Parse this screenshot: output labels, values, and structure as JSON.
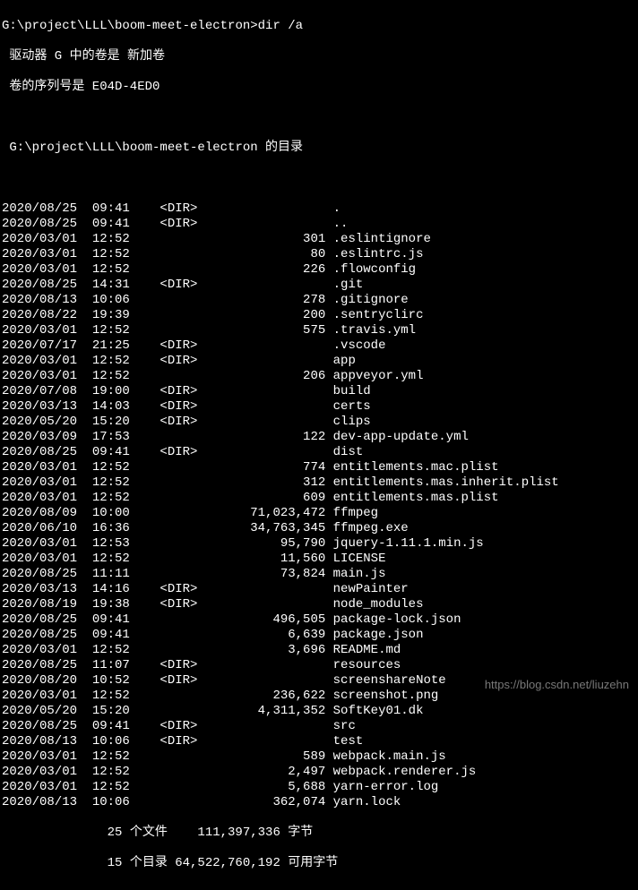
{
  "prompt": "G:\\project\\LLL\\boom-meet-electron>dir /a",
  "drive_info": " 驱动器 G 中的卷是 新加卷",
  "serial_info": " 卷的序列号是 E04D-4ED0",
  "dir_of": " G:\\project\\LLL\\boom-meet-electron 的目录",
  "entries": [
    {
      "date": "2020/08/25",
      "time": "09:41",
      "dir": "<DIR>",
      "size": "",
      "name": "."
    },
    {
      "date": "2020/08/25",
      "time": "09:41",
      "dir": "<DIR>",
      "size": "",
      "name": ".."
    },
    {
      "date": "2020/03/01",
      "time": "12:52",
      "dir": "",
      "size": "301",
      "name": ".eslintignore"
    },
    {
      "date": "2020/03/01",
      "time": "12:52",
      "dir": "",
      "size": "80",
      "name": ".eslintrc.js"
    },
    {
      "date": "2020/03/01",
      "time": "12:52",
      "dir": "",
      "size": "226",
      "name": ".flowconfig"
    },
    {
      "date": "2020/08/25",
      "time": "14:31",
      "dir": "<DIR>",
      "size": "",
      "name": ".git"
    },
    {
      "date": "2020/08/13",
      "time": "10:06",
      "dir": "",
      "size": "278",
      "name": ".gitignore"
    },
    {
      "date": "2020/08/22",
      "time": "19:39",
      "dir": "",
      "size": "200",
      "name": ".sentryclirc"
    },
    {
      "date": "2020/03/01",
      "time": "12:52",
      "dir": "",
      "size": "575",
      "name": ".travis.yml"
    },
    {
      "date": "2020/07/17",
      "time": "21:25",
      "dir": "<DIR>",
      "size": "",
      "name": ".vscode"
    },
    {
      "date": "2020/03/01",
      "time": "12:52",
      "dir": "<DIR>",
      "size": "",
      "name": "app"
    },
    {
      "date": "2020/03/01",
      "time": "12:52",
      "dir": "",
      "size": "206",
      "name": "appveyor.yml"
    },
    {
      "date": "2020/07/08",
      "time": "19:00",
      "dir": "<DIR>",
      "size": "",
      "name": "build"
    },
    {
      "date": "2020/03/13",
      "time": "14:03",
      "dir": "<DIR>",
      "size": "",
      "name": "certs"
    },
    {
      "date": "2020/05/20",
      "time": "15:20",
      "dir": "<DIR>",
      "size": "",
      "name": "clips"
    },
    {
      "date": "2020/03/09",
      "time": "17:53",
      "dir": "",
      "size": "122",
      "name": "dev-app-update.yml"
    },
    {
      "date": "2020/08/25",
      "time": "09:41",
      "dir": "<DIR>",
      "size": "",
      "name": "dist"
    },
    {
      "date": "2020/03/01",
      "time": "12:52",
      "dir": "",
      "size": "774",
      "name": "entitlements.mac.plist"
    },
    {
      "date": "2020/03/01",
      "time": "12:52",
      "dir": "",
      "size": "312",
      "name": "entitlements.mas.inherit.plist"
    },
    {
      "date": "2020/03/01",
      "time": "12:52",
      "dir": "",
      "size": "609",
      "name": "entitlements.mas.plist"
    },
    {
      "date": "2020/08/09",
      "time": "10:00",
      "dir": "",
      "size": "71,023,472",
      "name": "ffmpeg"
    },
    {
      "date": "2020/06/10",
      "time": "16:36",
      "dir": "",
      "size": "34,763,345",
      "name": "ffmpeg.exe"
    },
    {
      "date": "2020/03/01",
      "time": "12:53",
      "dir": "",
      "size": "95,790",
      "name": "jquery-1.11.1.min.js"
    },
    {
      "date": "2020/03/01",
      "time": "12:52",
      "dir": "",
      "size": "11,560",
      "name": "LICENSE"
    },
    {
      "date": "2020/08/25",
      "time": "11:11",
      "dir": "",
      "size": "73,824",
      "name": "main.js"
    },
    {
      "date": "2020/03/13",
      "time": "14:16",
      "dir": "<DIR>",
      "size": "",
      "name": "newPainter"
    },
    {
      "date": "2020/08/19",
      "time": "19:38",
      "dir": "<DIR>",
      "size": "",
      "name": "node_modules"
    },
    {
      "date": "2020/08/25",
      "time": "09:41",
      "dir": "",
      "size": "496,505",
      "name": "package-lock.json"
    },
    {
      "date": "2020/08/25",
      "time": "09:41",
      "dir": "",
      "size": "6,639",
      "name": "package.json"
    },
    {
      "date": "2020/03/01",
      "time": "12:52",
      "dir": "",
      "size": "3,696",
      "name": "README.md"
    },
    {
      "date": "2020/08/25",
      "time": "11:07",
      "dir": "<DIR>",
      "size": "",
      "name": "resources"
    },
    {
      "date": "2020/08/20",
      "time": "10:52",
      "dir": "<DIR>",
      "size": "",
      "name": "screenshareNote"
    },
    {
      "date": "2020/03/01",
      "time": "12:52",
      "dir": "",
      "size": "236,622",
      "name": "screenshot.png"
    },
    {
      "date": "2020/05/20",
      "time": "15:20",
      "dir": "",
      "size": "4,311,352",
      "name": "SoftKey01.dk"
    },
    {
      "date": "2020/08/25",
      "time": "09:41",
      "dir": "<DIR>",
      "size": "",
      "name": "src"
    },
    {
      "date": "2020/08/13",
      "time": "10:06",
      "dir": "<DIR>",
      "size": "",
      "name": "test"
    },
    {
      "date": "2020/03/01",
      "time": "12:52",
      "dir": "",
      "size": "589",
      "name": "webpack.main.js"
    },
    {
      "date": "2020/03/01",
      "time": "12:52",
      "dir": "",
      "size": "2,497",
      "name": "webpack.renderer.js"
    },
    {
      "date": "2020/03/01",
      "time": "12:52",
      "dir": "",
      "size": "5,688",
      "name": "yarn-error.log"
    },
    {
      "date": "2020/08/13",
      "time": "10:06",
      "dir": "",
      "size": "362,074",
      "name": "yarn.lock"
    }
  ],
  "summary_files": "              25 个文件    111,397,336 字节",
  "summary_dirs": "              15 个目录 64,522,760,192 可用字节",
  "watermark": "https://blog.csdn.net/liuzehn"
}
